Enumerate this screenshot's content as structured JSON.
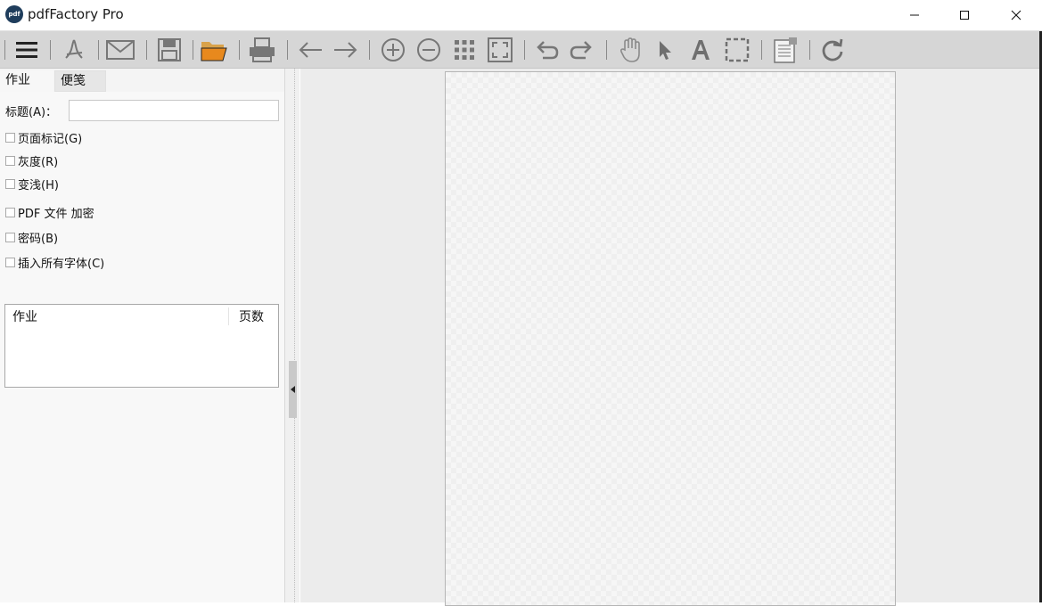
{
  "window": {
    "title": "pdfFactory Pro",
    "logo_text": "pdf"
  },
  "tabs": [
    {
      "label": "作业"
    },
    {
      "label": "便笺"
    }
  ],
  "form": {
    "title_label": "标题(A)：",
    "title_value": "",
    "checkboxes": [
      {
        "label": "页面标记(G)",
        "checked": false
      },
      {
        "label": "灰度(R)",
        "checked": false
      },
      {
        "label": "变浅(H)",
        "checked": false
      },
      {
        "label": "PDF 文件 加密",
        "checked": false
      },
      {
        "label": "密码(B)",
        "checked": false
      },
      {
        "label": "插入所有字体(C)",
        "checked": false
      }
    ]
  },
  "jobs_table": {
    "columns": [
      "作业",
      "页数"
    ],
    "rows": []
  },
  "toolbar_icons": [
    "menu-icon",
    "acrobat-icon",
    "mail-icon",
    "save-icon",
    "open-folder-icon",
    "print-icon",
    "back-arrow-icon",
    "forward-arrow-icon",
    "zoom-in-icon",
    "zoom-out-icon",
    "thumbnails-icon",
    "fit-page-icon",
    "undo-icon",
    "redo-icon",
    "hand-tool-icon",
    "pointer-icon",
    "text-tool-icon",
    "select-rect-icon",
    "page-info-icon",
    "refresh-icon"
  ],
  "colors": {
    "toolbar_bg": "#d6d6d6",
    "folder_accent": "#e8891d",
    "icon_gray": "#6f6f6f"
  }
}
